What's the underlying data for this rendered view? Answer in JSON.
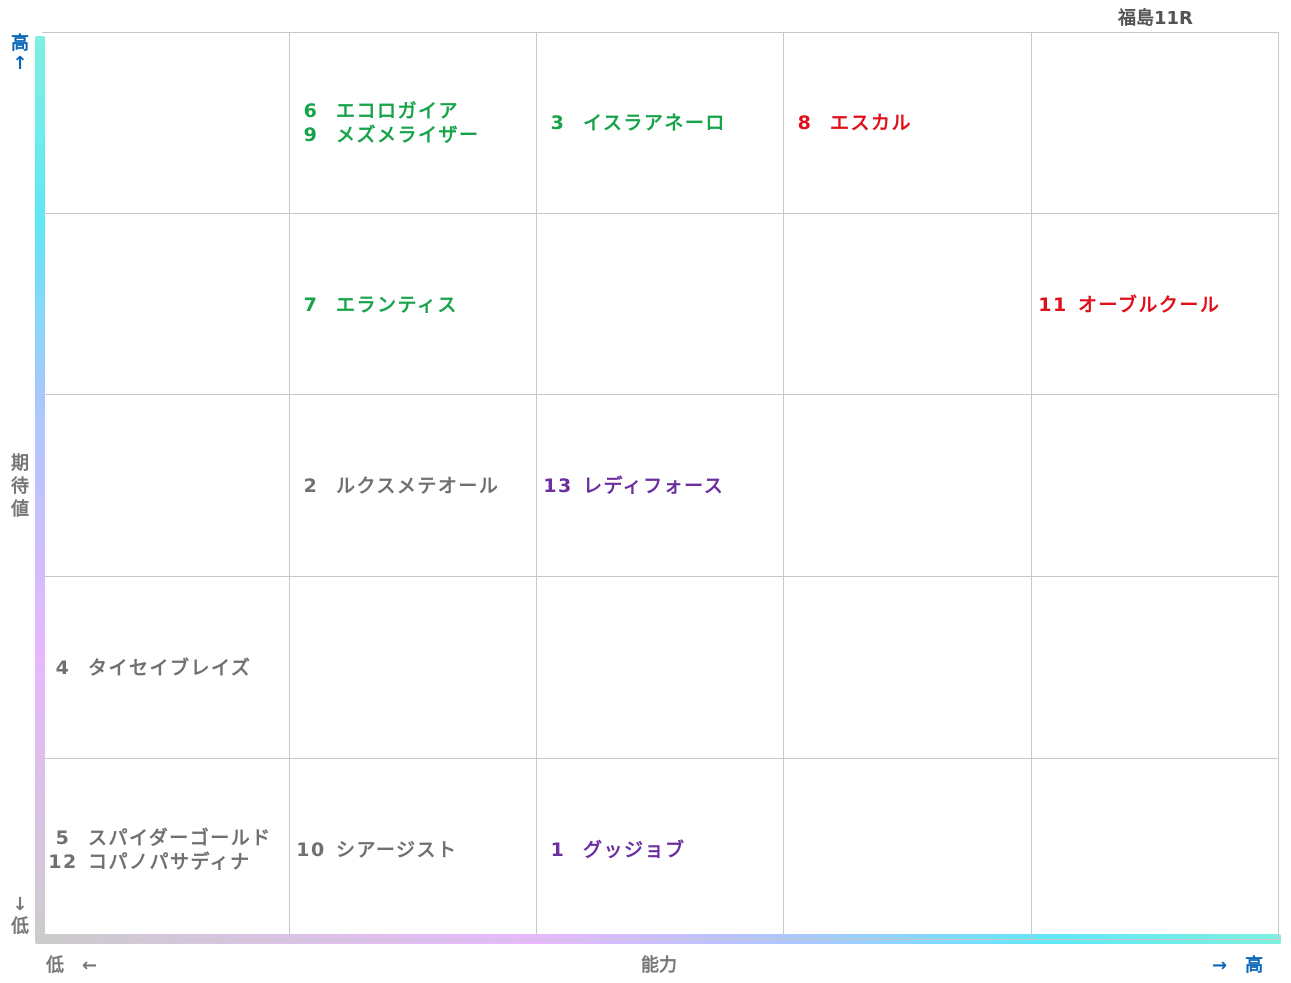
{
  "title": "福島11R",
  "axes": {
    "y_high": "高",
    "y_high_arrow": "↑",
    "y_low_arrow": "↓",
    "y_low": "低",
    "y_label": "期待値",
    "x_low": "低　←",
    "x_label": "能力",
    "x_high": "→　高"
  },
  "colors": {
    "green": "#16a34a",
    "red": "#e0101a",
    "purple": "#6b2fa0",
    "gray": "#707070"
  },
  "chart_data": {
    "type": "table",
    "x_axis": "能力",
    "y_axis": "期待値",
    "columns": 5,
    "rows": 5,
    "entries": [
      {
        "num": "6",
        "name": "エコロガイア",
        "col": 2,
        "row": 1,
        "color": "green"
      },
      {
        "num": "9",
        "name": "メズメライザー",
        "col": 2,
        "row": 1,
        "color": "green"
      },
      {
        "num": "3",
        "name": "イスラアネーロ",
        "col": 3,
        "row": 1,
        "color": "green"
      },
      {
        "num": "8",
        "name": "エスカル",
        "col": 4,
        "row": 1,
        "color": "red"
      },
      {
        "num": "7",
        "name": "エランティス",
        "col": 2,
        "row": 2,
        "color": "green"
      },
      {
        "num": "11",
        "name": "オーブルクール",
        "col": 5,
        "row": 2,
        "color": "red"
      },
      {
        "num": "2",
        "name": "ルクスメテオール",
        "col": 2,
        "row": 3,
        "color": "gray"
      },
      {
        "num": "13",
        "name": "レディフォース",
        "col": 3,
        "row": 3,
        "color": "purple"
      },
      {
        "num": "4",
        "name": "タイセイブレイズ",
        "col": 1,
        "row": 4,
        "color": "gray"
      },
      {
        "num": "5",
        "name": "スパイダーゴールド",
        "col": 1,
        "row": 5,
        "color": "gray"
      },
      {
        "num": "12",
        "name": "コパノパサディナ",
        "col": 1,
        "row": 5,
        "color": "gray"
      },
      {
        "num": "10",
        "name": "シアージスト",
        "col": 2,
        "row": 5,
        "color": "gray"
      },
      {
        "num": "1",
        "name": "グッジョブ",
        "col": 3,
        "row": 5,
        "color": "purple"
      }
    ]
  }
}
